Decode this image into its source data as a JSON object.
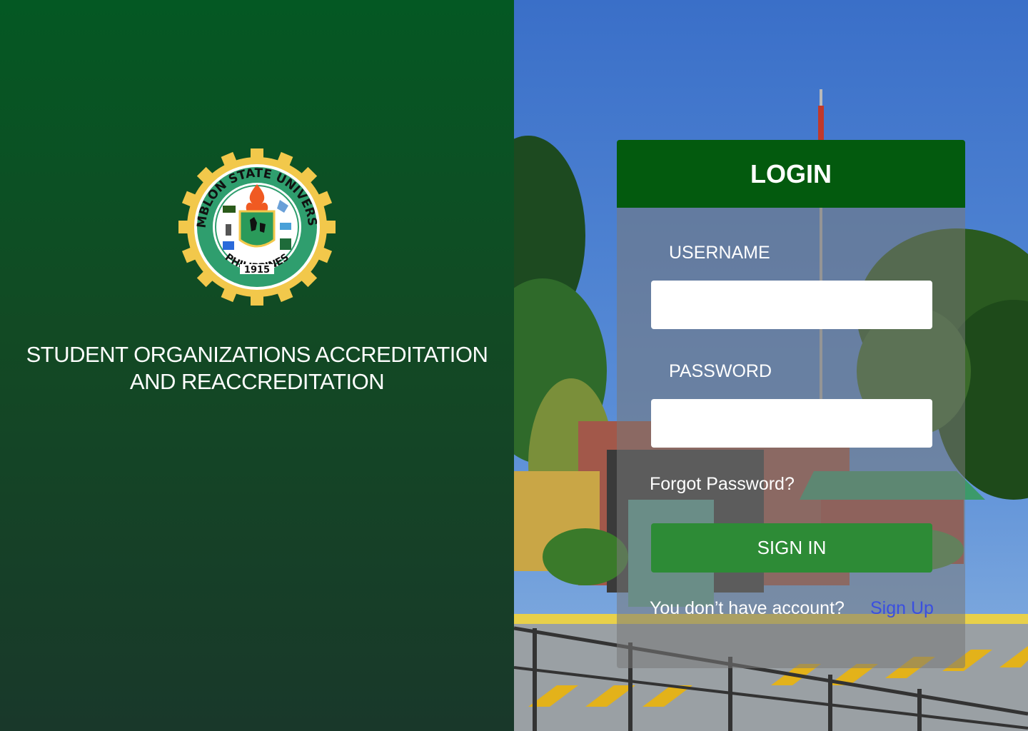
{
  "colors": {
    "left_gradient_top": "#045823",
    "left_gradient_bottom": "#19382a",
    "login_header": "#035a0e",
    "signin_button": "#2d8b36",
    "signup_link": "#3a4fe0",
    "seal_gold": "#f2c84b",
    "seal_green": "#2f9e6e"
  },
  "brand": {
    "seal": {
      "top_text": "ROMBLON STATE UNIVERSITY",
      "year": "1915",
      "bottom_text": "PHILIPPINES"
    },
    "title_line1": "STUDENT ORGANIZATIONS ACCREDITATION",
    "title_line2": "AND REACCREDITATION"
  },
  "login": {
    "header": "LOGIN",
    "username_label": "USERNAME",
    "username_value": "",
    "password_label": "PASSWORD",
    "password_value": "",
    "forgot_password": "Forgot  Password?",
    "signin_label": "SIGN IN",
    "no_account_text": "You don’t have account?",
    "signup_link": "Sign Up"
  },
  "icons": {
    "background_photo": "campus-gate-photo",
    "seal_logo": "university-seal-icon"
  }
}
